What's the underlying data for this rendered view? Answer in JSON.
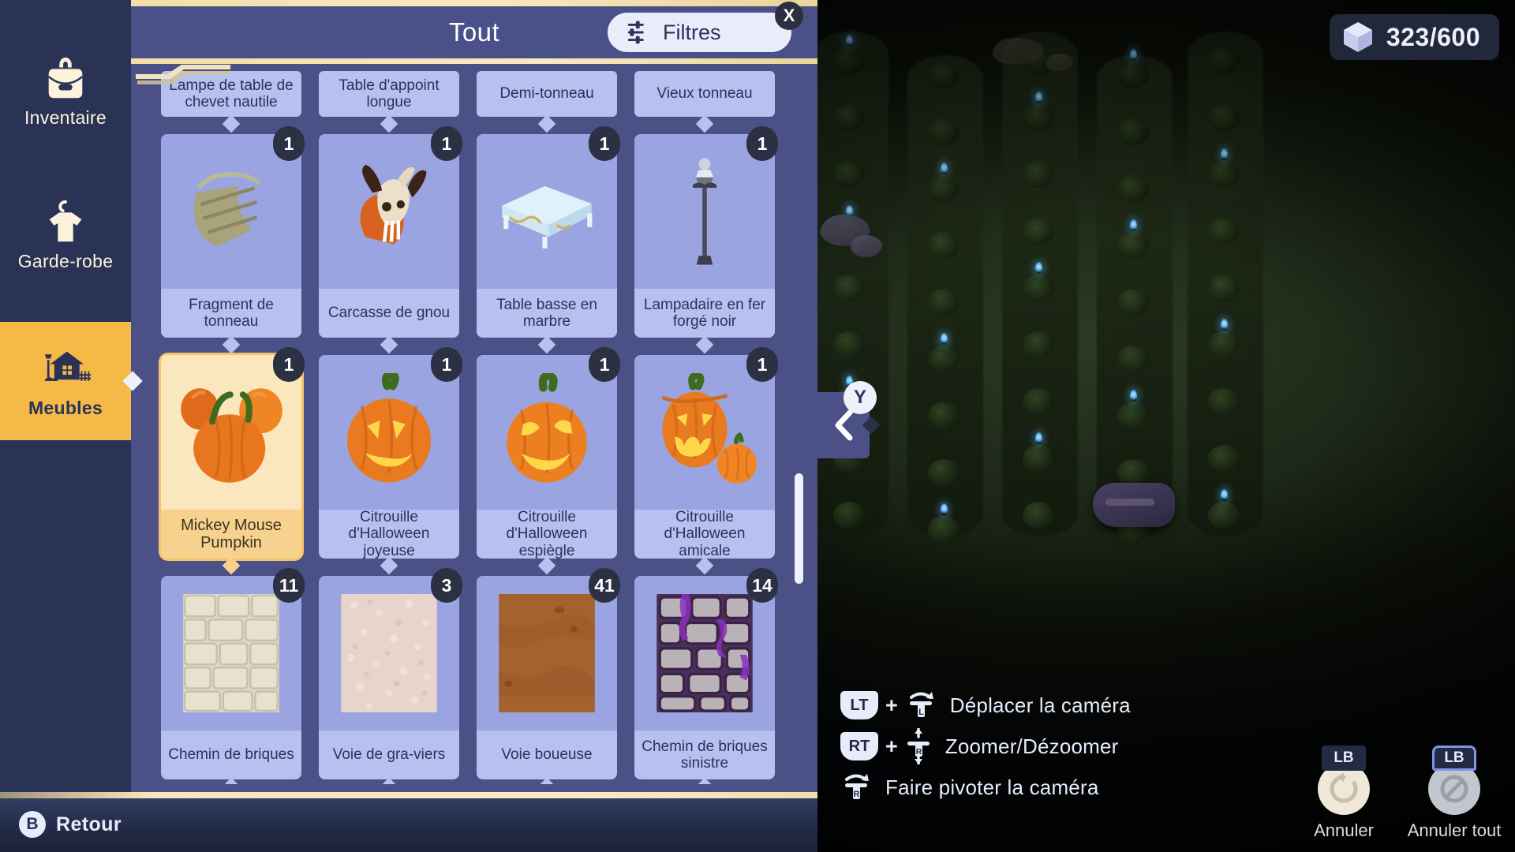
{
  "sidebar": {
    "items": [
      {
        "label": "Inventaire",
        "icon": "backpack-icon",
        "active": false
      },
      {
        "label": "Garde-robe",
        "icon": "hanger-shirt-icon",
        "active": false
      },
      {
        "label": "Meubles",
        "icon": "house-icon",
        "active": true
      }
    ]
  },
  "panel": {
    "title": "Tout",
    "filters_label": "Filtres",
    "filters_icon": "sliders-icon",
    "close_label": "X",
    "scrollbar": true
  },
  "grid": {
    "partial_row_labels": [
      "Lampe de table de chevet nautile",
      "Table d'appoint longue",
      "Demi-tonneau",
      "Vieux tonneau"
    ],
    "rows": [
      [
        {
          "name": "Fragment de tonneau",
          "qty": "1",
          "art": "barrel-fragment",
          "selected": false
        },
        {
          "name": "Carcasse de gnou",
          "qty": "1",
          "art": "gnu-skull",
          "selected": false
        },
        {
          "name": "Table basse en marbre",
          "qty": "1",
          "art": "marble-table",
          "selected": false
        },
        {
          "name": "Lampadaire en fer forgé noir",
          "qty": "1",
          "art": "street-lamp",
          "selected": false
        }
      ],
      [
        {
          "name": "Mickey Mouse Pumpkin",
          "qty": "1",
          "art": "mickey-pumpkin",
          "selected": true
        },
        {
          "name": "Citrouille d'Halloween joyeuse",
          "qty": "1",
          "art": "jack-o-lantern-happy",
          "selected": false
        },
        {
          "name": "Citrouille d'Halloween espiègle",
          "qty": "1",
          "art": "jack-o-lantern-mischievous",
          "selected": false
        },
        {
          "name": "Citrouille d'Halloween amicale",
          "qty": "1",
          "art": "jack-o-lantern-friendly",
          "selected": false
        }
      ],
      [
        {
          "name": "Chemin de briques",
          "qty": "11",
          "art": "brick-path",
          "selected": false
        },
        {
          "name": "Voie de gra-viers",
          "qty": "3",
          "art": "gravel-path",
          "selected": false
        },
        {
          "name": "Voie boueuse",
          "qty": "41",
          "art": "mud-path",
          "selected": false
        },
        {
          "name": "Chemin de briques sinistre",
          "qty": "14",
          "art": "sinister-brick-path",
          "selected": false
        }
      ]
    ]
  },
  "collapse_tab": {
    "button": "Y",
    "icon": "chevron-left-icon"
  },
  "counter": {
    "value": "323/600",
    "icon": "cube-icon"
  },
  "hints": [
    {
      "trigger": "LT",
      "plus": "+",
      "stick": "left-stick-rotate-icon",
      "text": "Déplacer la caméra"
    },
    {
      "trigger": "RT",
      "plus": "+",
      "stick": "right-stick-vertical-icon",
      "text": "Zoomer/Dézoomer"
    },
    {
      "trigger": "",
      "plus": "",
      "stick": "right-stick-rotate-icon",
      "text": "Faire pivoter la caméra"
    }
  ],
  "bottom_bar": {
    "button": "B",
    "label": "Retour"
  },
  "actions": [
    {
      "tag": "LB",
      "label": "Annuler",
      "icon": "undo-icon",
      "style": "cream",
      "outlined": false
    },
    {
      "tag": "LB",
      "label": "Annuler tout",
      "icon": "cancel-all-icon",
      "style": "grey",
      "outlined": true
    }
  ],
  "colors": {
    "panel_bg": "#4b5087",
    "sidebar_bg": "#2a3356",
    "accent_gold": "#f5b948",
    "cell_bg": "#9aa4e0",
    "cell_label_bg": "#b7c0f0",
    "selected_bg": "#fbe7bd",
    "text_light": "#e8ebfa"
  }
}
